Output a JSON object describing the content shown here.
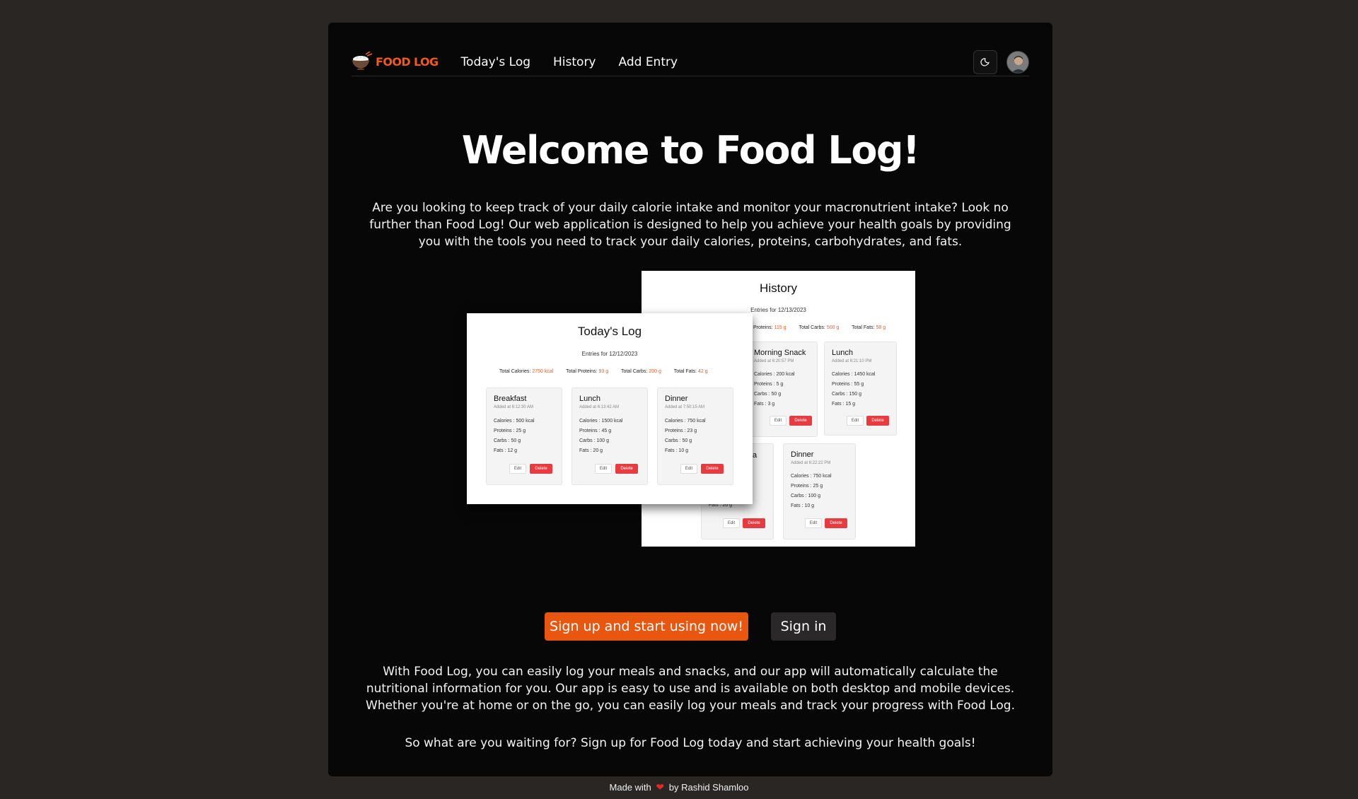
{
  "nav": {
    "brand": "FOOD LOG",
    "links": [
      "Today's Log",
      "History",
      "Add Entry"
    ]
  },
  "hero": {
    "title": "Welcome to Food Log!",
    "intro": "Are you looking to keep track of your daily calorie intake and monitor your macronutrient intake? Look no further than Food Log! Our web application is designed to help you achieve your health goals by providing you with the tools you need to track your daily calories, proteins, carbohydrates, and fats."
  },
  "preview_today": {
    "title": "Today's Log",
    "subtitle": "Entries for 12/12/2023",
    "totals": [
      {
        "label": "Total Calories:",
        "value": "2750 kcal"
      },
      {
        "label": "Total Proteins:",
        "value": "93 g"
      },
      {
        "label": "Total Carbs:",
        "value": "200 g"
      },
      {
        "label": "Total Fats:",
        "value": "42 g"
      }
    ],
    "cards": [
      {
        "name": "Breakfast",
        "time": "Added at 6:12:30 AM",
        "lines": [
          "Calories : 500 kcal",
          "Proteins : 25 g",
          "Carbs : 50 g",
          "Fats : 12 g"
        ]
      },
      {
        "name": "Lunch",
        "time": "Added at 6:13:42 AM",
        "lines": [
          "Calories : 1500 kcal",
          "Proteins : 45 g",
          "Carbs : 100 g",
          "Fats : 20 g"
        ]
      },
      {
        "name": "Dinner",
        "time": "Added at 7:50:15 AM",
        "lines": [
          "Calories : 750 kcal",
          "Proteins : 23 g",
          "Carbs : 50 g",
          "Fats : 10 g"
        ]
      }
    ],
    "edit_label": "Edit",
    "delete_label": "Delete"
  },
  "preview_history": {
    "title": "History",
    "subtitle": "Entries for 12/13/2023",
    "totals": [
      {
        "label": "Proteins:",
        "value": "115 g"
      },
      {
        "label": "Total Carbs:",
        "value": "500 g"
      },
      {
        "label": "Total Fats:",
        "value": "58 g"
      }
    ],
    "cards": [
      {
        "name": "Morning Snack",
        "time": "Added at 6:20:57 PM",
        "lines": [
          "Calories : 200 kcal",
          "Proteins : 5 g",
          "Carbs : 50 g",
          "Fats : 3 g"
        ]
      },
      {
        "name": "Lunch",
        "time": "Added at 6:21:10 PM",
        "lines": [
          "Calories : 1450 kcal",
          "Proteins : 55 g",
          "Carbs : 150 g",
          "Fats : 15 g"
        ]
      },
      {
        "name": "a",
        "time": "",
        "lines": [
          "Fats : 20 g"
        ]
      },
      {
        "name": "Dinner",
        "time": "Added at 6:22:22 PM",
        "lines": [
          "Calories : 750 kcal",
          "Proteins : 25 g",
          "Carbs : 100 g",
          "Fats : 10 g"
        ]
      }
    ],
    "edit_label": "Edit",
    "delete_label": "Delete"
  },
  "cta": {
    "primary": "Sign up and start using now!",
    "secondary": "Sign in"
  },
  "body": {
    "paragraph": "With Food Log, you can easily log your meals and snacks, and our app will automatically calculate the nutritional information for you. Our app is easy to use and is available on both desktop and mobile devices. Whether you're at home or on the go, you can easily log your meals and track your progress with Food Log.",
    "closing": "So what are you waiting for? Sign up for Food Log today and start achieving your health goals!"
  },
  "footer": {
    "made_with": "Made with",
    "author": "by Rashid Shamloo"
  },
  "colors": {
    "accent": "#f2581f",
    "cta": "#e8560f",
    "delete": "#e83b3f",
    "background": "#2a2624",
    "panel": "#070707"
  },
  "icons": {
    "brand": "food-bowl-icon",
    "theme": "moon-icon",
    "avatar": "user-avatar",
    "heart": "heart-icon"
  }
}
